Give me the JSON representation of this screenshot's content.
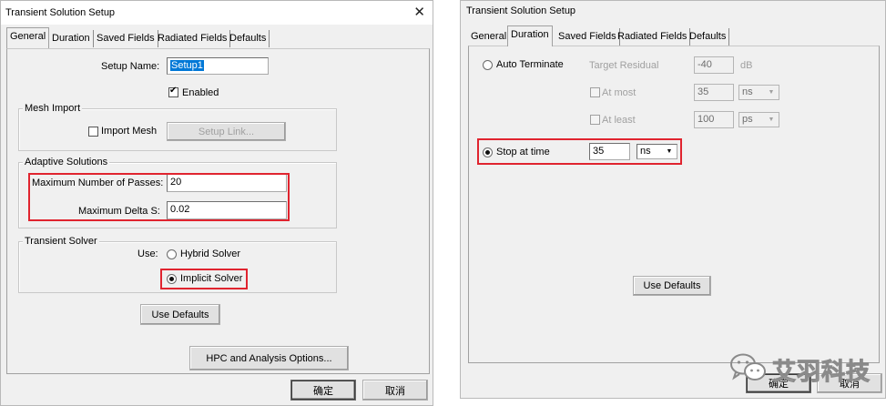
{
  "left_dialog": {
    "title": "Transient Solution Setup",
    "tabs": [
      "General",
      "Duration",
      "Saved Fields",
      "Radiated Fields",
      "Defaults"
    ],
    "setup_name_label": "Setup Name:",
    "setup_name_value": "Setup1",
    "enabled_label": "Enabled",
    "enabled_checked": true,
    "mesh_import_group": "Mesh Import",
    "import_mesh_label": "Import Mesh",
    "import_mesh_checked": false,
    "setup_link_button": "Setup Link...",
    "adaptive_group": "Adaptive Solutions",
    "max_passes_label": "Maximum Number of Passes:",
    "max_passes_value": "20",
    "max_delta_label": "Maximum Delta S:",
    "max_delta_value": "0.02",
    "transient_solver_group": "Transient Solver",
    "use_label": "Use:",
    "hybrid_solver_label": "Hybrid Solver",
    "implicit_solver_label": "Implicit Solver",
    "selected_solver": "Implicit Solver",
    "use_defaults_button": "Use Defaults",
    "hpc_button": "HPC and Analysis Options...",
    "ok_button": "确定",
    "cancel_button": "取消"
  },
  "right_dialog": {
    "title": "Transient Solution Setup",
    "tabs": [
      "General",
      "Duration",
      "Saved Fields",
      "Radiated Fields",
      "Defaults"
    ],
    "auto_terminate_label": "Auto Terminate",
    "target_residual_label": "Target Residual",
    "target_residual_value": "-40",
    "target_residual_unit": "dB",
    "at_most_label": "At most",
    "at_most_value": "35",
    "at_most_unit": "ns",
    "at_least_label": "At least",
    "at_least_value": "100",
    "at_least_unit": "ps",
    "stop_at_time_label": "Stop at time",
    "stop_at_time_value": "35",
    "stop_at_time_unit": "ns",
    "selected_mode": "Stop at time",
    "use_defaults_button": "Use Defaults",
    "ok_button": "确定",
    "cancel_button": "取消"
  },
  "watermark": {
    "text": "艾羽科技"
  },
  "colors": {
    "highlight_red": "#e0242f",
    "selection_blue": "#0078d7",
    "dialog_bg": "#f0f0f0"
  }
}
